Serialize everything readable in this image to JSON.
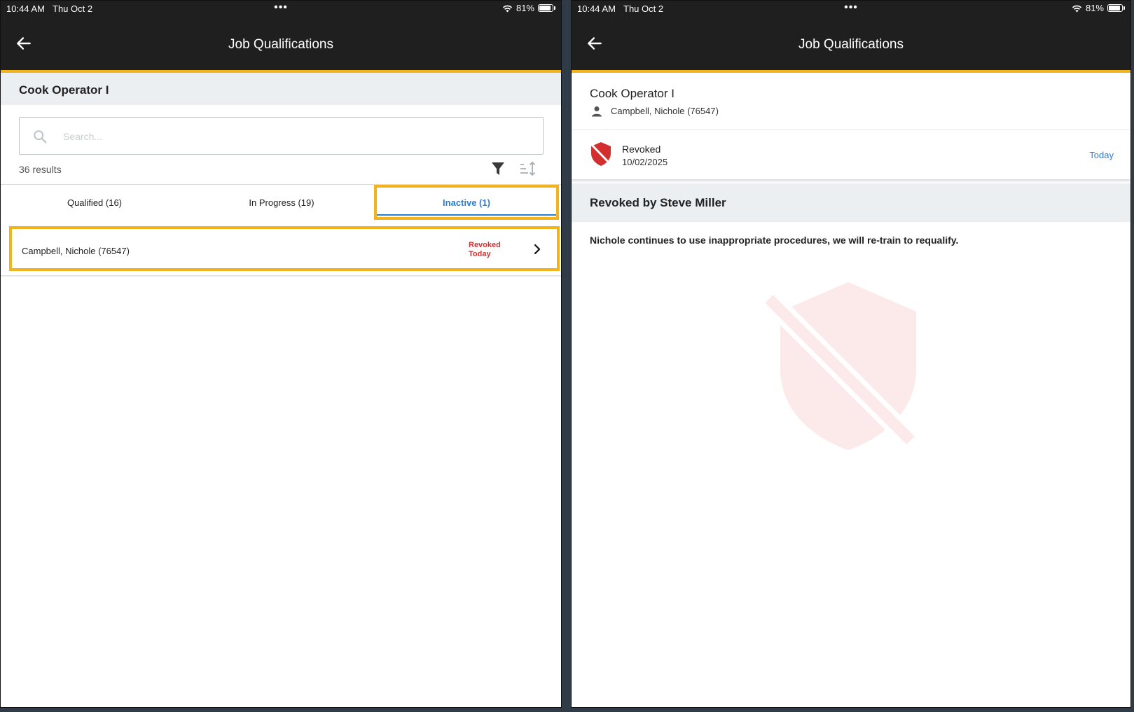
{
  "status_bar": {
    "time": "10:44 AM",
    "date": "Thu Oct 2",
    "dots": "•••",
    "battery": "81%"
  },
  "left": {
    "appbar_title": "Job Qualifications",
    "job_title": "Cook Operator I",
    "search": {
      "placeholder": "Search...",
      "value": ""
    },
    "results_count": "36 results",
    "tabs": [
      {
        "label": "Qualified (16)"
      },
      {
        "label": "In Progress (19)"
      },
      {
        "label": "Inactive (1)",
        "selected": true
      }
    ],
    "list": [
      {
        "name": "Campbell, Nichole (76547)",
        "status_line1": "Revoked",
        "status_line2": "Today"
      }
    ]
  },
  "right": {
    "appbar_title": "Job Qualifications",
    "job_title": "Cook Operator I",
    "person": "Campbell, Nichole (76547)",
    "status": {
      "label": "Revoked",
      "date": "10/02/2025",
      "relative": "Today"
    },
    "revoked_by": "Revoked by Steve Miller",
    "note": "Nichole continues to use inappropriate procedures, we will re-train to requalify."
  },
  "colors": {
    "appbar": "#1f1f1f",
    "accent_yellow": "#f3b41b",
    "link_blue": "#2a7fd4",
    "revoked_red": "#d32f2f",
    "section_gray": "#eceff2"
  },
  "icons": [
    "back-arrow-icon",
    "wifi-icon",
    "battery-icon",
    "search-icon",
    "filter-icon",
    "sort-icon",
    "chevron-right-icon",
    "person-icon",
    "revoked-shield-icon"
  ]
}
